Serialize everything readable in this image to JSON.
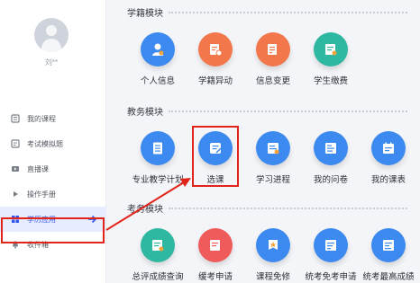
{
  "sidebar": {
    "username": "刘**",
    "items": [
      {
        "label": "我的课程",
        "icon": "book-icon",
        "active": false
      },
      {
        "label": "考试模拟题",
        "icon": "exam-icon",
        "active": false
      },
      {
        "label": "直播课",
        "icon": "live-icon",
        "active": false
      },
      {
        "label": "操作手册",
        "icon": "manual-icon",
        "active": false
      },
      {
        "label": "学历应用",
        "icon": "grid-icon",
        "active": true
      },
      {
        "label": "收件箱",
        "icon": "bell-icon",
        "active": false
      }
    ]
  },
  "sections": [
    {
      "title": "学籍模块",
      "tiles": [
        {
          "label": "个人信息",
          "icon": "user-icon",
          "color": "#3c8af0"
        },
        {
          "label": "学籍异动",
          "icon": "student-status-change-icon",
          "color": "#f2774a"
        },
        {
          "label": "信息变更",
          "icon": "info-change-icon",
          "color": "#f2774a"
        },
        {
          "label": "学生缴费",
          "icon": "payment-icon",
          "color": "#2eb8a1"
        }
      ]
    },
    {
      "title": "教务模块",
      "tiles": [
        {
          "label": "专业教学计划",
          "icon": "plan-icon",
          "color": "#3c8af0"
        },
        {
          "label": "选课",
          "icon": "course-select-icon",
          "color": "#3c8af0"
        },
        {
          "label": "学习进程",
          "icon": "progress-icon",
          "color": "#3c8af0"
        },
        {
          "label": "我的问卷",
          "icon": "questionnaire-icon",
          "color": "#3c8af0"
        },
        {
          "label": "我的课表",
          "icon": "timetable-icon",
          "color": "#3c8af0"
        }
      ]
    },
    {
      "title": "考务模块",
      "tiles": [
        {
          "label": "总评成绩查询",
          "icon": "score-query-icon",
          "color": "#2eb8a1"
        },
        {
          "label": "缓考申请",
          "icon": "defer-exam-icon",
          "color": "#ef5b5b"
        },
        {
          "label": "课程免修",
          "icon": "course-exempt-icon",
          "color": "#3c8af0"
        },
        {
          "label": "统考免考申请",
          "icon": "exam-exempt-icon",
          "color": "#3c8af0"
        },
        {
          "label": "统考最高成绩",
          "icon": "top-score-icon",
          "color": "#3c8af0"
        }
      ]
    }
  ],
  "annotation_color": "#e2231a"
}
